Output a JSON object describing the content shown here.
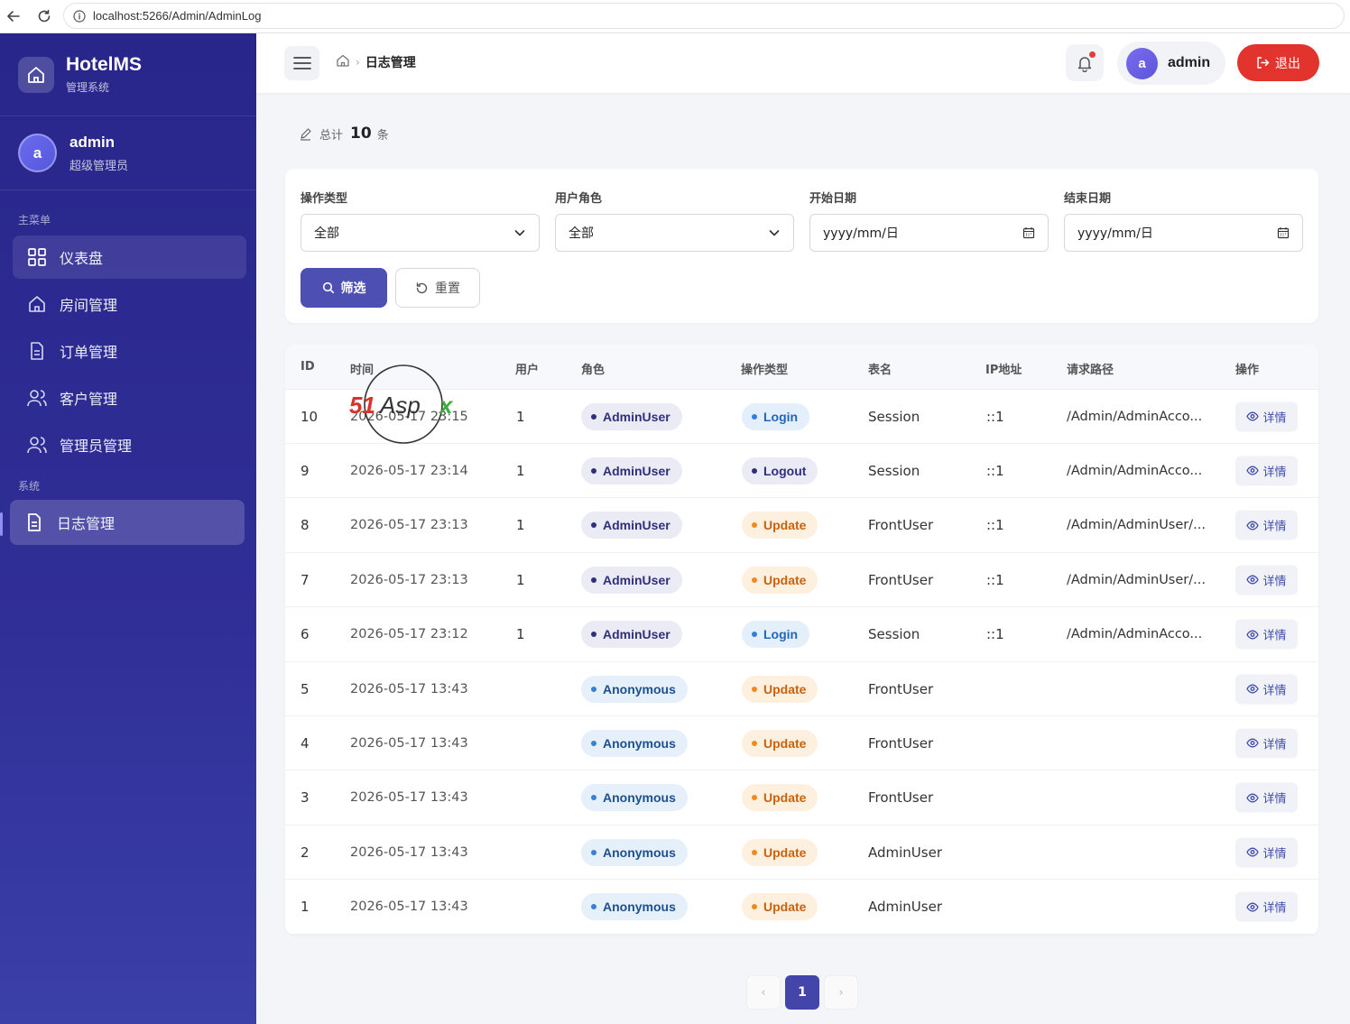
{
  "browser": {
    "url": "localhost:5266/Admin/AdminLog"
  },
  "sidebar": {
    "brand_title": "HotelMS",
    "brand_subtitle": "管理系统",
    "user_avatar": "a",
    "user_name": "admin",
    "user_role": "超级管理员",
    "section_main": "主菜单",
    "section_system": "系统",
    "items": [
      {
        "label": "仪表盘",
        "icon": "dashboard-icon"
      },
      {
        "label": "房间管理",
        "icon": "home-icon"
      },
      {
        "label": "订单管理",
        "icon": "document-icon"
      },
      {
        "label": "客户管理",
        "icon": "users-icon"
      },
      {
        "label": "管理员管理",
        "icon": "users-icon"
      },
      {
        "label": "日志管理",
        "icon": "document-icon",
        "active": true
      }
    ]
  },
  "header": {
    "breadcrumb_current": "日志管理",
    "user_avatar": "a",
    "user_name": "admin",
    "logout_label": "退出"
  },
  "summary": {
    "prefix": "总计",
    "count": "10",
    "suffix": "条"
  },
  "filters": {
    "op_type_label": "操作类型",
    "op_type_value": "全部",
    "role_label": "用户角色",
    "role_value": "全部",
    "start_label": "开始日期",
    "start_placeholder": "yyyy/mm/日",
    "end_label": "结束日期",
    "end_placeholder": "yyyy/mm/日",
    "filter_button": "筛选",
    "reset_button": "重置"
  },
  "table": {
    "headers": [
      "ID",
      "时间",
      "用户",
      "角色",
      "操作类型",
      "表名",
      "IP地址",
      "请求路径",
      "操作"
    ],
    "detail_label": "详情",
    "rows": [
      {
        "id": "10",
        "time": "2026-05-17 23:15",
        "user": "1",
        "role": "AdminUser",
        "op": "Login",
        "table": "Session",
        "ip": "::1",
        "path": "/Admin/AdminAcco..."
      },
      {
        "id": "9",
        "time": "2026-05-17 23:14",
        "user": "1",
        "role": "AdminUser",
        "op": "Logout",
        "table": "Session",
        "ip": "::1",
        "path": "/Admin/AdminAcco..."
      },
      {
        "id": "8",
        "time": "2026-05-17 23:13",
        "user": "1",
        "role": "AdminUser",
        "op": "Update",
        "table": "FrontUser",
        "ip": "::1",
        "path": "/Admin/AdminUser/..."
      },
      {
        "id": "7",
        "time": "2026-05-17 23:13",
        "user": "1",
        "role": "AdminUser",
        "op": "Update",
        "table": "FrontUser",
        "ip": "::1",
        "path": "/Admin/AdminUser/..."
      },
      {
        "id": "6",
        "time": "2026-05-17 23:12",
        "user": "1",
        "role": "AdminUser",
        "op": "Login",
        "table": "Session",
        "ip": "::1",
        "path": "/Admin/AdminAcco..."
      },
      {
        "id": "5",
        "time": "2026-05-17 13:43",
        "user": "",
        "role": "Anonymous",
        "op": "Update",
        "table": "FrontUser",
        "ip": "",
        "path": ""
      },
      {
        "id": "4",
        "time": "2026-05-17 13:43",
        "user": "",
        "role": "Anonymous",
        "op": "Update",
        "table": "FrontUser",
        "ip": "",
        "path": ""
      },
      {
        "id": "3",
        "time": "2026-05-17 13:43",
        "user": "",
        "role": "Anonymous",
        "op": "Update",
        "table": "FrontUser",
        "ip": "",
        "path": ""
      },
      {
        "id": "2",
        "time": "2026-05-17 13:43",
        "user": "",
        "role": "Anonymous",
        "op": "Update",
        "table": "AdminUser",
        "ip": "",
        "path": ""
      },
      {
        "id": "1",
        "time": "2026-05-17 13:43",
        "user": "",
        "role": "Anonymous",
        "op": "Update",
        "table": "AdminUser",
        "ip": "",
        "path": ""
      }
    ]
  },
  "pagination": {
    "prev": "‹",
    "current": "1",
    "next": "›"
  },
  "watermark": {
    "text": "51Aspx"
  },
  "colors": {
    "sidebar": "#28268a",
    "primary": "#4d4fb3",
    "danger": "#e2342c"
  }
}
